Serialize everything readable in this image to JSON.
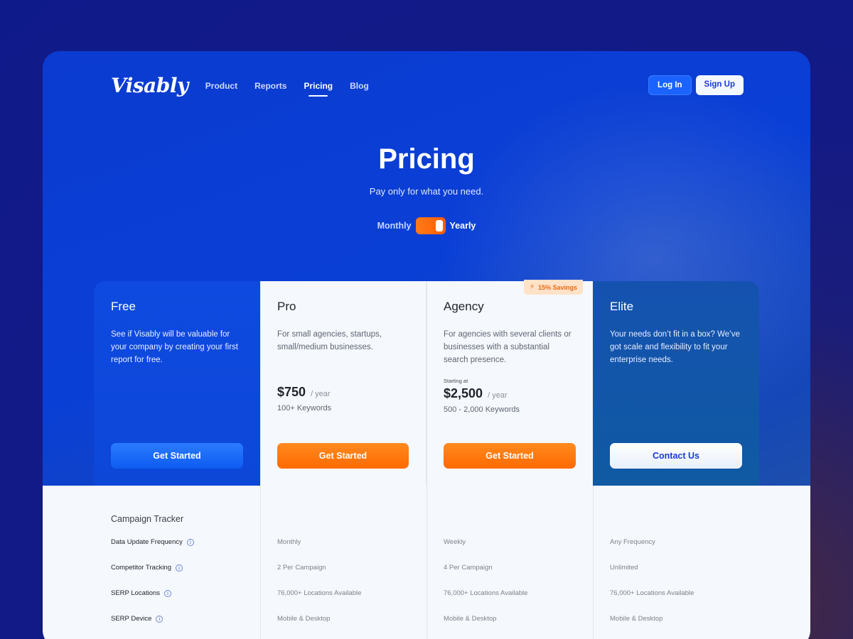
{
  "brand": {
    "logo": "Visably"
  },
  "nav": {
    "links": [
      "Product",
      "Reports",
      "Pricing",
      "Blog"
    ],
    "active": "Pricing",
    "login_label": "Log In",
    "signup_label": "Sign Up"
  },
  "hero": {
    "title": "Pricing",
    "subtitle": "Pay only for what you need.",
    "toggle_left": "Monthly",
    "toggle_right": "Yearly",
    "toggle_state": "Yearly"
  },
  "plans": [
    {
      "name": "Free",
      "description": "See if Visably will be valuable for your company by creating your first report for free.",
      "cta": "Get Started"
    },
    {
      "name": "Pro",
      "description": "For small agencies, startups, small/medium businesses.",
      "price": "$750",
      "period": "/ year",
      "keywords": "100+ Keywords",
      "cta": "Get Started"
    },
    {
      "name": "Agency",
      "badge": "15% Savings",
      "description": "For agencies with several clients or businesses with a substantial search presence.",
      "starting_label": "Starting at",
      "price": "$2,500",
      "period": "/ year",
      "keywords": "500 - 2,000 Keywords",
      "cta": "Get Started"
    },
    {
      "name": "Elite",
      "description": "Your needs don’t fit in a box? We’ve got scale and flexibility to fit your enterprise needs.",
      "cta": "Contact Us"
    }
  ],
  "features": {
    "heading": "Campaign Tracker",
    "rows": [
      {
        "name": "Data Update Frequency",
        "pro": "Monthly",
        "agency": "Weekly",
        "elite": "Any Frequency"
      },
      {
        "name": "Competitor Tracking",
        "pro": "2 Per Campaign",
        "agency": "4 Per Campaign",
        "elite": "Unlimited"
      },
      {
        "name": "SERP Locations",
        "pro": "76,000+ Locations Available",
        "agency": "76,000+ Locations Available",
        "elite": "76,000+ Locations Available"
      },
      {
        "name": "SERP Device",
        "pro": "Mobile & Desktop",
        "agency": "Mobile & Desktop",
        "elite": "Mobile & Desktop"
      }
    ]
  },
  "colors": {
    "primary_blue": "#0a3fd6",
    "accent_orange": "#ff6a00",
    "badge_bg": "#ffe2c8"
  }
}
